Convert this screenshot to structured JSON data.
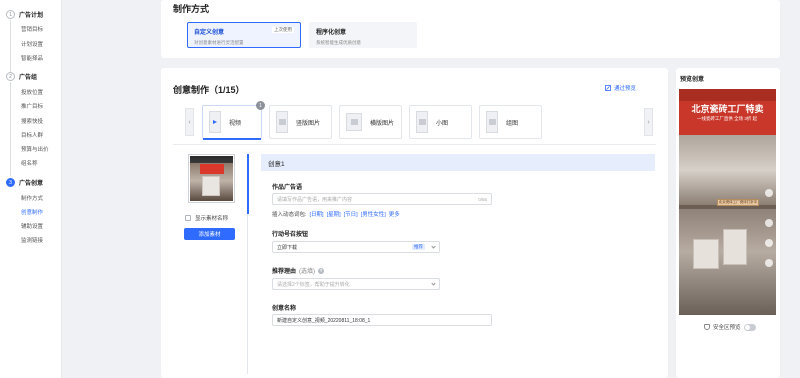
{
  "sidebar": {
    "steps": [
      {
        "num": "1",
        "title": "广告计划",
        "items": [
          "营销目标",
          "计划设置",
          "智能择品"
        ]
      },
      {
        "num": "2",
        "title": "广告组",
        "items": [
          "投放位置",
          "推广目标",
          "搜索快投",
          "目标人群",
          "预算与出价",
          "组名称"
        ]
      },
      {
        "num": "3",
        "title": "广告创意",
        "items": [
          "制作方式",
          "创意制作",
          "辅助设置",
          "监测链接"
        ]
      }
    ],
    "active_item": "创意制作"
  },
  "make_mode": {
    "title": "制作方式",
    "options": [
      {
        "title": "自定义创意",
        "desc": "对创意素材进行灵活配置",
        "tag": "上次使用",
        "selected": true
      },
      {
        "title": "程序化创意",
        "desc": "系统智能生成优质创意",
        "tag": "",
        "selected": false
      }
    ]
  },
  "creative": {
    "title": "创意制作（1/15）",
    "preview_label": "通过预览",
    "tabs": [
      {
        "label": "视频",
        "badge": "1",
        "active": true
      },
      {
        "label": "竖版图片",
        "badge": "",
        "active": false
      },
      {
        "label": "横版图片",
        "badge": "",
        "active": false
      },
      {
        "label": "小图",
        "badge": "",
        "active": false
      },
      {
        "label": "组图",
        "badge": "",
        "active": false
      }
    ],
    "show_material_name": "显示素材名称",
    "add_material": "添加素材",
    "item_title": "创意1",
    "ad_text": {
      "label": "作品广告语",
      "placeholder": "请填写作品广告语，用来推广内容",
      "counter": "0/55",
      "insert_label": "插入动态词包:",
      "insert_links": [
        "[日期]",
        "[星期]",
        "[节日]",
        "[男性女性]",
        "更多"
      ]
    },
    "action_button": {
      "label": "行动号召按钮",
      "value": "立即下载",
      "tag": "推荐"
    },
    "recommend_reason": {
      "label": "推荐理由",
      "optional": "(选填)",
      "placeholder": "请选择2个标签，帮助于提升转化"
    },
    "creative_name": {
      "label": "创意名称",
      "value": "新建自定义创意_视频_20220811_18:08_1"
    }
  },
  "preview": {
    "title": "预览创意",
    "phone": {
      "title": "北京瓷砖工厂特卖",
      "subtitle": "一线瓷砖工厂直供 全场 3折 起",
      "banner": "北京瓷砖工厂瓷砖打折中"
    },
    "safe_area_label": "安全区预览",
    "safe_area_on": false
  }
}
